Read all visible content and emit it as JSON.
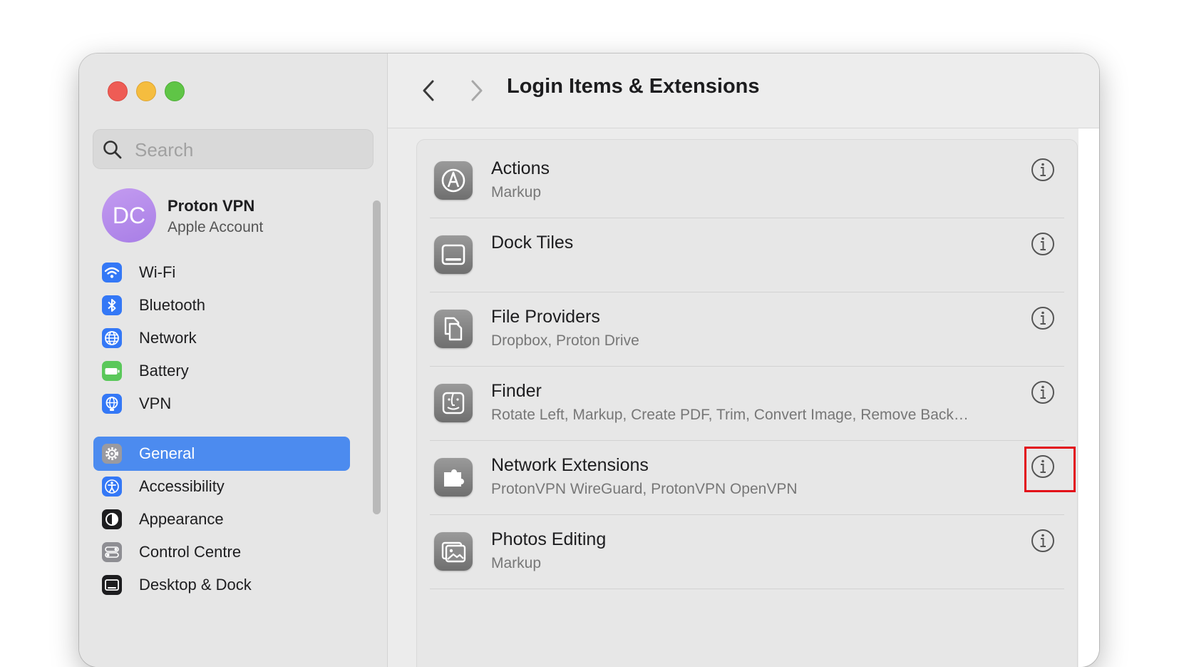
{
  "search": {
    "placeholder": "Search"
  },
  "account": {
    "initials": "DC",
    "name": "Proton VPN",
    "subtitle": "Apple Account"
  },
  "sidebar": {
    "items": [
      {
        "label": "Wi-Fi",
        "icon": "wifi-icon",
        "color": "#3478f6"
      },
      {
        "label": "Bluetooth",
        "icon": "bluetooth-icon",
        "color": "#3478f6"
      },
      {
        "label": "Network",
        "icon": "globe-icon",
        "color": "#3478f6"
      },
      {
        "label": "Battery",
        "icon": "battery-icon",
        "color": "#5ac85a"
      },
      {
        "label": "VPN",
        "icon": "vpn-globe-icon",
        "color": "#3478f6"
      },
      {
        "label": "General",
        "icon": "gear-icon",
        "color": "#8e8e93",
        "selected": true
      },
      {
        "label": "Accessibility",
        "icon": "accessibility-icon",
        "color": "#3478f6"
      },
      {
        "label": "Appearance",
        "icon": "appearance-icon",
        "color": "#1d1d1f"
      },
      {
        "label": "Control Centre",
        "icon": "control-centre-icon",
        "color": "#8e8e93"
      },
      {
        "label": "Desktop & Dock",
        "icon": "desktop-dock-icon",
        "color": "#1d1d1f"
      }
    ]
  },
  "header": {
    "title": "Login Items & Extensions"
  },
  "rows": [
    {
      "title": "Actions",
      "subtitle": "Markup",
      "icon": "actions-icon"
    },
    {
      "title": "Dock Tiles",
      "subtitle": "",
      "icon": "dock-tiles-icon"
    },
    {
      "title": "File Providers",
      "subtitle": "Dropbox, Proton Drive",
      "icon": "file-providers-icon"
    },
    {
      "title": "Finder",
      "subtitle": "Rotate Left, Markup, Create PDF, Trim, Convert Image, Remove Back…",
      "icon": "finder-icon"
    },
    {
      "title": "Network Extensions",
      "subtitle": "ProtonVPN WireGuard, ProtonVPN OpenVPN",
      "icon": "network-extensions-icon",
      "highlighted": true
    },
    {
      "title": "Photos Editing",
      "subtitle": "Markup",
      "icon": "photos-editing-icon"
    }
  ],
  "colors": {
    "selection": "#4c8bef",
    "highlight_box": "#e20d18"
  }
}
